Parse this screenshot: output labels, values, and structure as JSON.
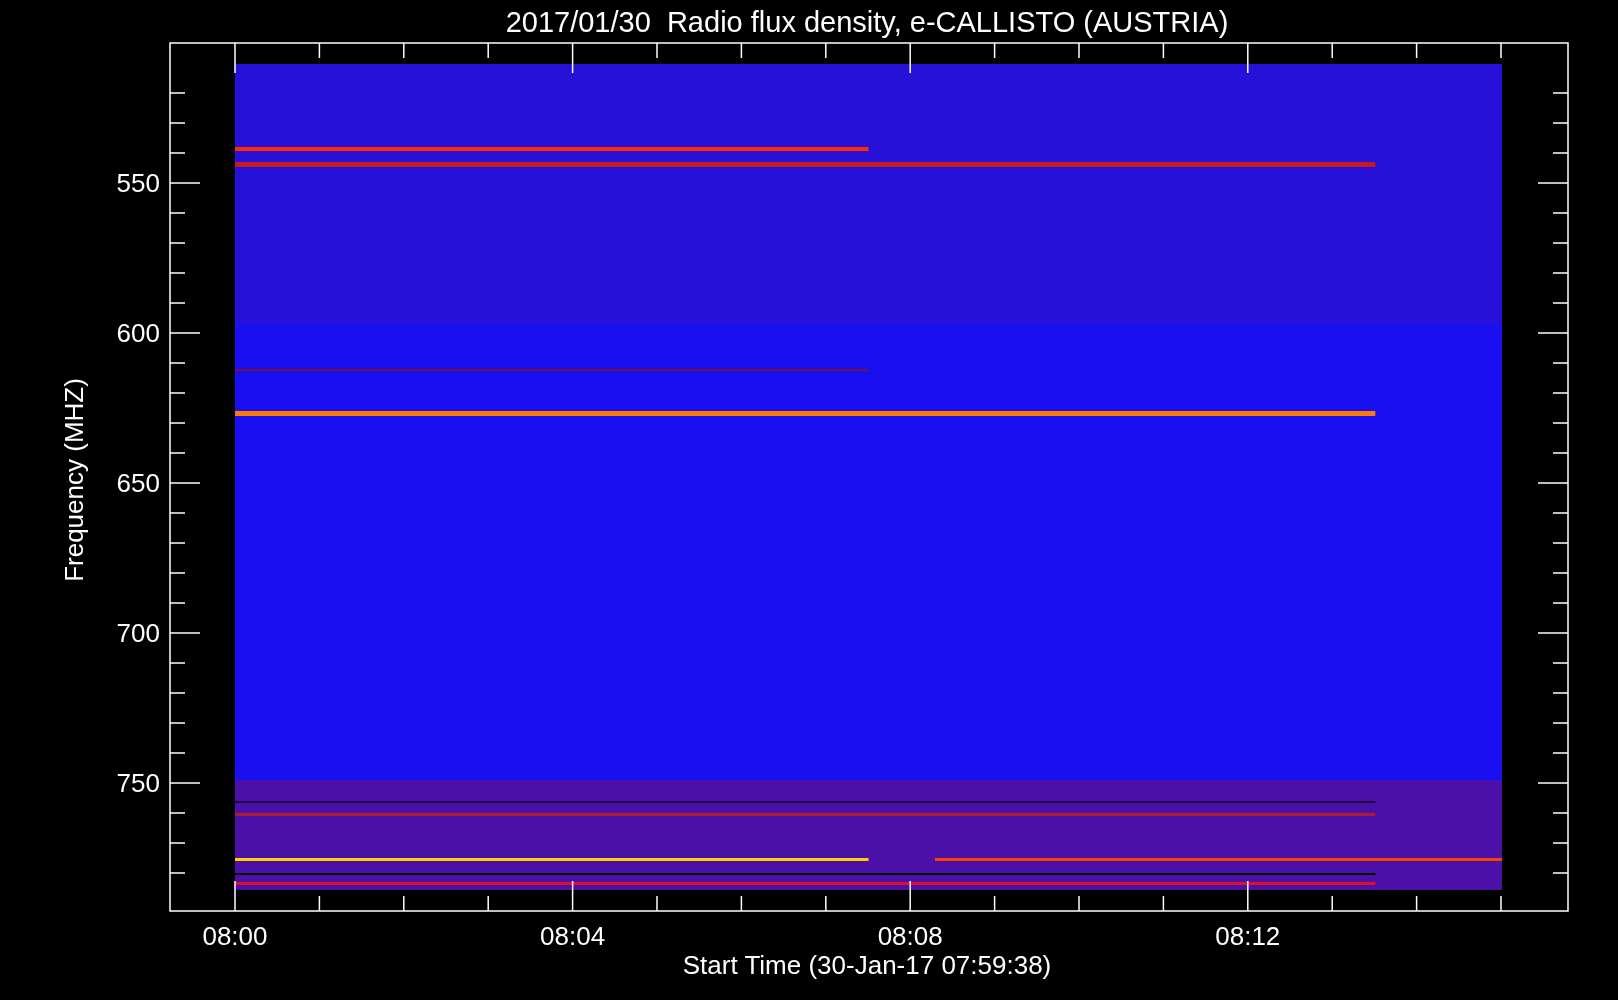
{
  "title": "2017/01/30  Radio flux density, e-CALLISTO (AUSTRIA)",
  "y_axis": {
    "label": "Frequency (MHZ)",
    "ticks": [
      "550",
      "600",
      "650",
      "700",
      "750"
    ]
  },
  "x_axis": {
    "label": "Start Time (30-Jan-17 07:59:38)",
    "ticks": [
      "08:00",
      "08:04",
      "08:08",
      "08:12"
    ]
  }
}
